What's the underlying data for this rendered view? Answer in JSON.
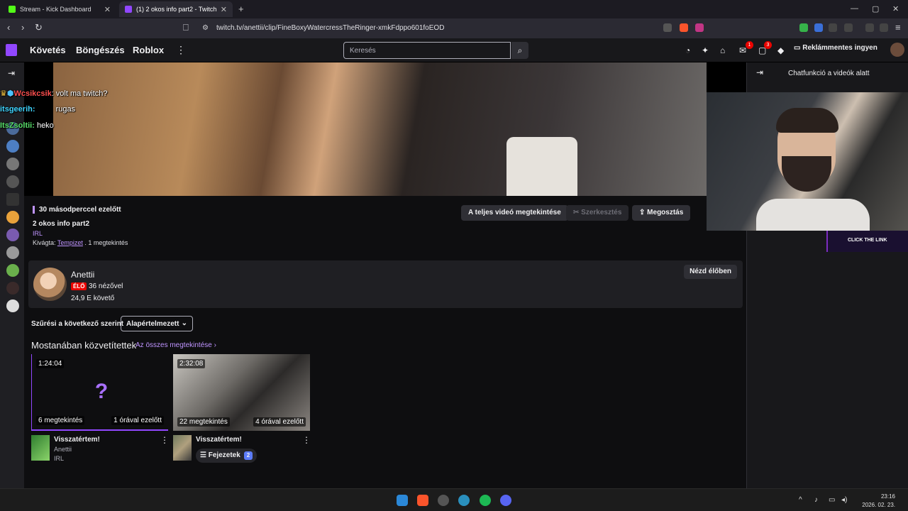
{
  "browser": {
    "tabs": [
      {
        "title": "Stream - Kick Dashboard",
        "active": false
      },
      {
        "title": "(1) 2 okos info part2 - Twitch",
        "active": true
      }
    ],
    "url": "twitch.tv/anettii/clip/FineBoxyWatercressTheRinger-xmkFdppo601foEOD"
  },
  "nav": {
    "links": [
      "Követés",
      "Böngészés",
      "Roblox"
    ],
    "search_placeholder": "Keresés",
    "notif_badges": [
      "1",
      "3"
    ],
    "adfree_label": "Reklámmentes ingyen"
  },
  "video": {
    "chat": [
      {
        "user": "Wcsikcsik",
        "msg": ": volt ma twitch?",
        "color": "#ff4f4f"
      },
      {
        "user": "itsgeerih:",
        "msg": "rugas",
        "color": "#3fd4ff"
      },
      {
        "user": "ItsZsoltii:",
        "msg": " heko",
        "color": "#58e06a"
      }
    ]
  },
  "clip": {
    "ago": "30 másodperccel ezelőtt",
    "title": "2 okos info part2",
    "category": "IRL",
    "clipped_by_prefix": "Kivágta: ",
    "clipped_by": "Tempizet",
    "views": " . 1 megtekintés",
    "actions": {
      "full_video": "A teljes videó megtekintése",
      "edit": "Szerkesztés",
      "share": "Megosztás"
    }
  },
  "channel": {
    "name": "Anettii",
    "live": "ÉLŐ",
    "viewers": "36 nézővel",
    "followers": "24,9 E követő",
    "watch_live": "Nézd élőben"
  },
  "filter": {
    "label": "Szűrési a következő szerint",
    "value": "Alapértelmezett"
  },
  "recent": {
    "title": "Mostanában közvetítettek",
    "see_all": "Az összes megtekintése",
    "items": [
      {
        "duration": "1:24:04",
        "views": "6 megtekintés",
        "ago": "1 órával ezelőtt",
        "title": "Visszatértem!",
        "channel": "Anettii",
        "category": "IRL"
      },
      {
        "duration": "2:32:08",
        "views": "22 megtekintés",
        "ago": "4 órával ezelőtt",
        "title": "Visszatértem!",
        "chapters_label": "Fejezetek",
        "chapters_count": "2"
      }
    ]
  },
  "right_panel": {
    "title": "Chatfunkció a videók alatt",
    "overlay_text": "CLICK THE LINK"
  },
  "taskbar": {
    "time": "23:16",
    "date": "2026. 02. 23."
  }
}
